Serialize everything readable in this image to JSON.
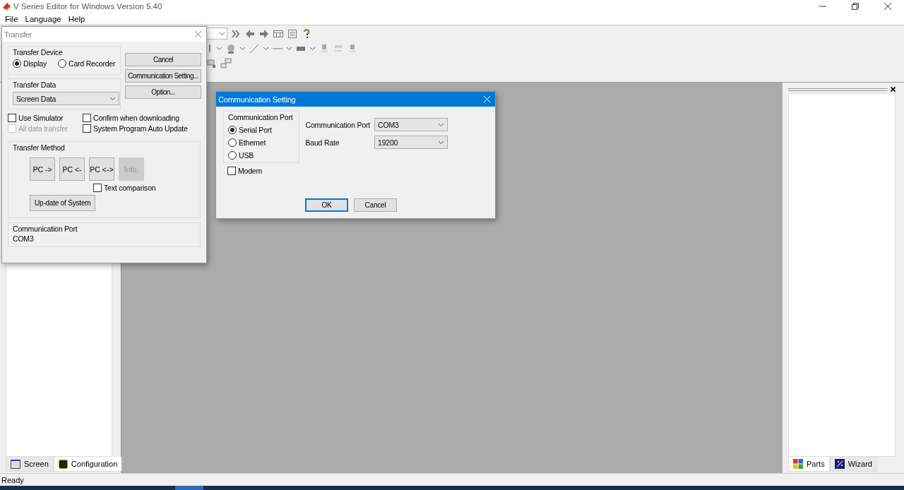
{
  "window": {
    "title": "V Series Editor for Windows Version 5.40"
  },
  "menu": [
    "File",
    "Language",
    "Help"
  ],
  "left_panel": {
    "tabs": [
      {
        "label": "Screen",
        "selected": false
      },
      {
        "label": "Configuration",
        "selected": true
      }
    ]
  },
  "right_panel": {
    "tabs": [
      {
        "label": "Parts",
        "selected": true
      },
      {
        "label": "Wizard",
        "selected": false
      }
    ]
  },
  "status_bar": "Ready",
  "transfer_dialog": {
    "title": "Transfer",
    "transfer_device": {
      "label": "Transfer Device",
      "options": [
        {
          "label": "Display",
          "selected": true
        },
        {
          "label": "Card Recorder",
          "selected": false
        }
      ]
    },
    "buttons": [
      "Cancel",
      "Communication Setting...",
      "Option..."
    ],
    "transfer_data": {
      "label": "Transfer Data",
      "value": "Screen Data"
    },
    "options": [
      {
        "label": "Use Simulator",
        "checked": false,
        "disabled": false
      },
      {
        "label": "Confirm when downloading",
        "checked": false,
        "disabled": false
      },
      {
        "label": "All data transfer",
        "checked": false,
        "disabled": true
      },
      {
        "label": "System Program Auto Update",
        "checked": false,
        "disabled": false
      }
    ],
    "transfer_method": {
      "label": "Transfer Method",
      "buttons": [
        {
          "label": "PC ->",
          "disabled": false
        },
        {
          "label": "PC <-",
          "disabled": false
        },
        {
          "label": "PC <->",
          "disabled": false
        },
        {
          "label": "Info.",
          "disabled": true
        }
      ],
      "text_comparison": {
        "label": "Text comparison",
        "checked": false
      },
      "update_button": "Up-date of System"
    },
    "communication_port": {
      "label": "Communication Port",
      "value": "COM3"
    }
  },
  "comm_dialog": {
    "title": "Communication Setting",
    "port_group": {
      "label": "Communication Port",
      "options": [
        {
          "label": "Serial Port",
          "selected": true
        },
        {
          "label": "Ethernet",
          "selected": false
        },
        {
          "label": "USB",
          "selected": false
        }
      ]
    },
    "modem": {
      "label": "Modem",
      "checked": false
    },
    "fields": [
      {
        "label": "Communication Port",
        "value": "COM3"
      },
      {
        "label": "Baud Rate",
        "value": "19200"
      }
    ],
    "buttons": [
      {
        "label": "OK",
        "default": true
      },
      {
        "label": "Cancel",
        "default": false
      }
    ]
  }
}
